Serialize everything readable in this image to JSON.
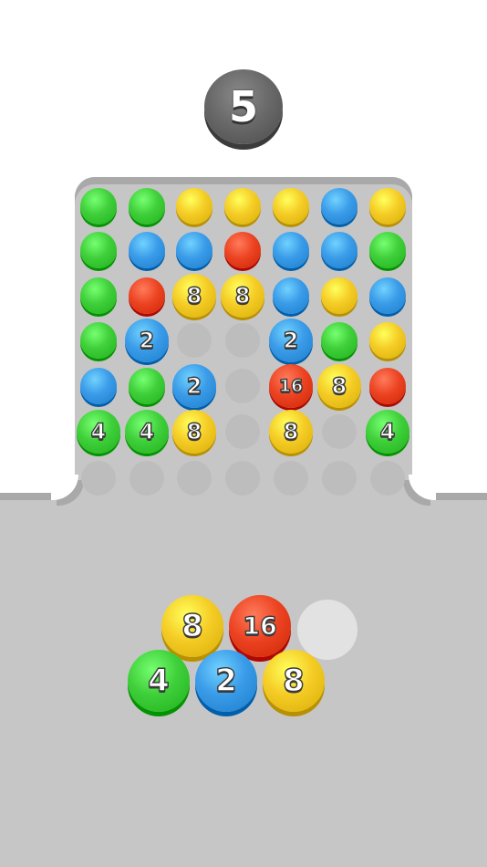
{
  "level": "5",
  "colors": {
    "green": "#3fcf3a",
    "blue": "#3a9be8",
    "yellow": "#f5cc25",
    "red": "#ec4423",
    "empty": "#bdbdbd"
  },
  "board": {
    "rows": [
      [
        {
          "color": "green"
        },
        {
          "color": "green"
        },
        {
          "color": "yellow"
        },
        {
          "color": "yellow"
        },
        {
          "color": "yellow"
        },
        {
          "color": "blue"
        },
        {
          "color": "yellow"
        }
      ],
      [
        {
          "color": "green"
        },
        {
          "color": "blue"
        },
        {
          "color": "blue"
        },
        {
          "color": "red"
        },
        {
          "color": "blue"
        },
        {
          "color": "blue"
        },
        {
          "color": "green"
        }
      ],
      [
        {
          "color": "green"
        },
        {
          "color": "red"
        },
        {
          "color": "yellow",
          "label": "8"
        },
        {
          "color": "yellow",
          "label": "8"
        },
        {
          "color": "blue"
        },
        {
          "color": "yellow"
        },
        {
          "color": "blue"
        }
      ],
      [
        {
          "color": "green"
        },
        {
          "color": "blue",
          "label": "2"
        },
        {
          "color": "empty"
        },
        {
          "color": "empty"
        },
        {
          "color": "blue",
          "label": "2"
        },
        {
          "color": "green"
        },
        {
          "color": "yellow"
        }
      ],
      [
        {
          "color": "blue"
        },
        {
          "color": "green"
        },
        {
          "color": "blue",
          "label": "2"
        },
        {
          "color": "empty"
        },
        {
          "color": "red",
          "label": "16"
        },
        {
          "color": "yellow",
          "label": "8"
        },
        {
          "color": "red"
        }
      ],
      [
        {
          "color": "green",
          "label": "4"
        },
        {
          "color": "green",
          "label": "4"
        },
        {
          "color": "yellow",
          "label": "8"
        },
        {
          "color": "empty"
        },
        {
          "color": "yellow",
          "label": "8"
        },
        {
          "color": "empty"
        },
        {
          "color": "green",
          "label": "4"
        }
      ],
      [
        {
          "color": "empty"
        },
        {
          "color": "empty"
        },
        {
          "color": "empty"
        },
        {
          "color": "empty"
        },
        {
          "color": "empty"
        },
        {
          "color": "empty"
        },
        {
          "color": "empty"
        }
      ]
    ]
  },
  "tray": [
    {
      "color": "yellow",
      "label": "8"
    },
    {
      "color": "red",
      "label": "16"
    },
    {
      "color": "empty"
    },
    {
      "color": "green",
      "label": "4"
    },
    {
      "color": "blue",
      "label": "2"
    },
    {
      "color": "yellow",
      "label": "8"
    }
  ]
}
